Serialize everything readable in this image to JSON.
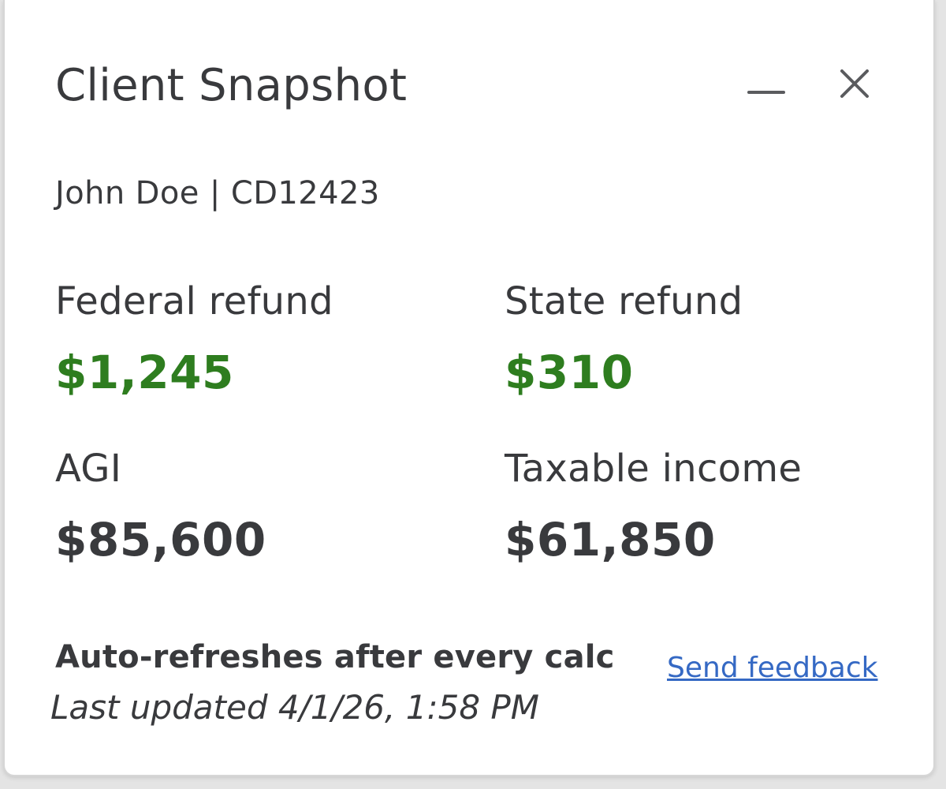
{
  "header": {
    "title": "Client Snapshot",
    "minimize_icon": "minimize-icon",
    "close_icon": "close-icon"
  },
  "client": {
    "name": "John Doe",
    "separator": " | ",
    "id": "CD12423"
  },
  "metrics": {
    "federal_refund": {
      "label": "Federal refund",
      "value": "$1,245"
    },
    "state_refund": {
      "label": "State refund",
      "value": "$310"
    },
    "agi": {
      "label": "AGI",
      "value": "$85,600"
    },
    "taxable_income": {
      "label": "Taxable income",
      "value": "$61,850"
    }
  },
  "footer": {
    "auto_refresh_text": "Auto-refreshes after every calc",
    "last_updated_text": "Last updated 4/1/26, 1:58 PM",
    "feedback_link": "Send feedback"
  },
  "colors": {
    "refund_green": "#2e7d1f",
    "text_dark": "#393a3d",
    "link_blue": "#3569c4"
  }
}
